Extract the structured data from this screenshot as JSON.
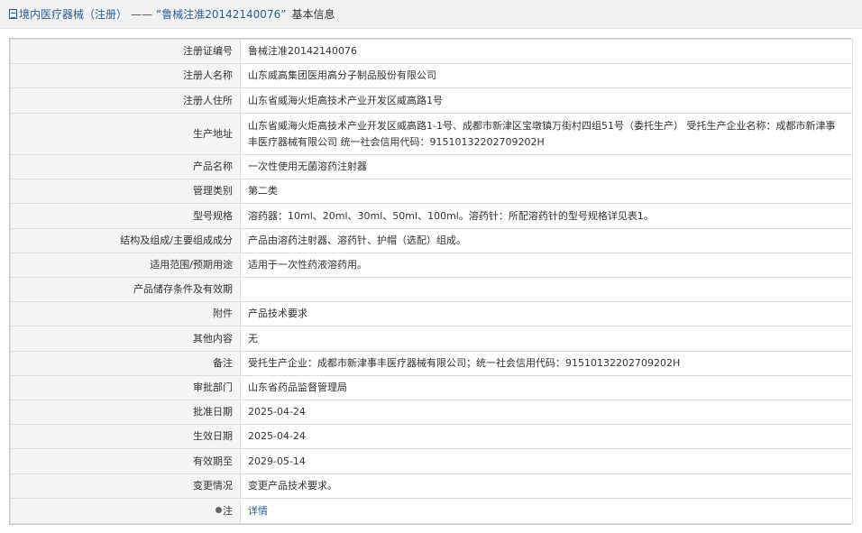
{
  "title": {
    "category_link": "境内医疗器械（注册）",
    "separator": "——",
    "reg_quoted": "“鲁械注准20142140076”",
    "suffix": "基本信息"
  },
  "rows": [
    {
      "label": "注册证编号",
      "value": "鲁械注准20142140076"
    },
    {
      "label": "注册人名称",
      "value": "山东威高集团医用高分子制品股份有限公司"
    },
    {
      "label": "注册人住所",
      "value": "山东省威海火炬高技术产业开发区威高路1号"
    },
    {
      "label": "生产地址",
      "value": "山东省威海火炬高技术产业开发区威高路1-1号、成都市新津区宝墩镇万街村四组51号（委托生产） 受托生产企业名称：成都市新津事丰医疗器械有限公司 统一社会信用代码：91510132202709202H"
    },
    {
      "label": "产品名称",
      "value": "一次性使用无菌溶药注射器"
    },
    {
      "label": "管理类别",
      "value": "第二类"
    },
    {
      "label": "型号规格",
      "value": "溶药器：10ml、20ml、30ml、50ml、100ml。溶药针：所配溶药针的型号规格详见表1。"
    },
    {
      "label": "结构及组成/主要组成成分",
      "value": "产品由溶药注射器、溶药针、护帽（选配）组成。"
    },
    {
      "label": "适用范围/预期用途",
      "value": "适用于一次性药液溶药用。"
    },
    {
      "label": "产品储存条件及有效期",
      "value": ""
    },
    {
      "label": "附件",
      "value": "产品技术要求"
    },
    {
      "label": "其他内容",
      "value": "无"
    },
    {
      "label": "备注",
      "value": "受托生产企业：成都市新津事丰医疗器械有限公司；统一社会信用代码：91510132202709202H"
    },
    {
      "label": "审批部门",
      "value": "山东省药品监督管理局"
    },
    {
      "label": "批准日期",
      "value": "2025-04-24"
    },
    {
      "label": "生效日期",
      "value": "2025-04-24"
    },
    {
      "label": "有效期至",
      "value": "2029-05-14"
    },
    {
      "label": "变更情况",
      "value": "变更产品技术要求。"
    }
  ],
  "note_row": {
    "icon": "note-icon",
    "label": "注",
    "link_text": "详情"
  }
}
